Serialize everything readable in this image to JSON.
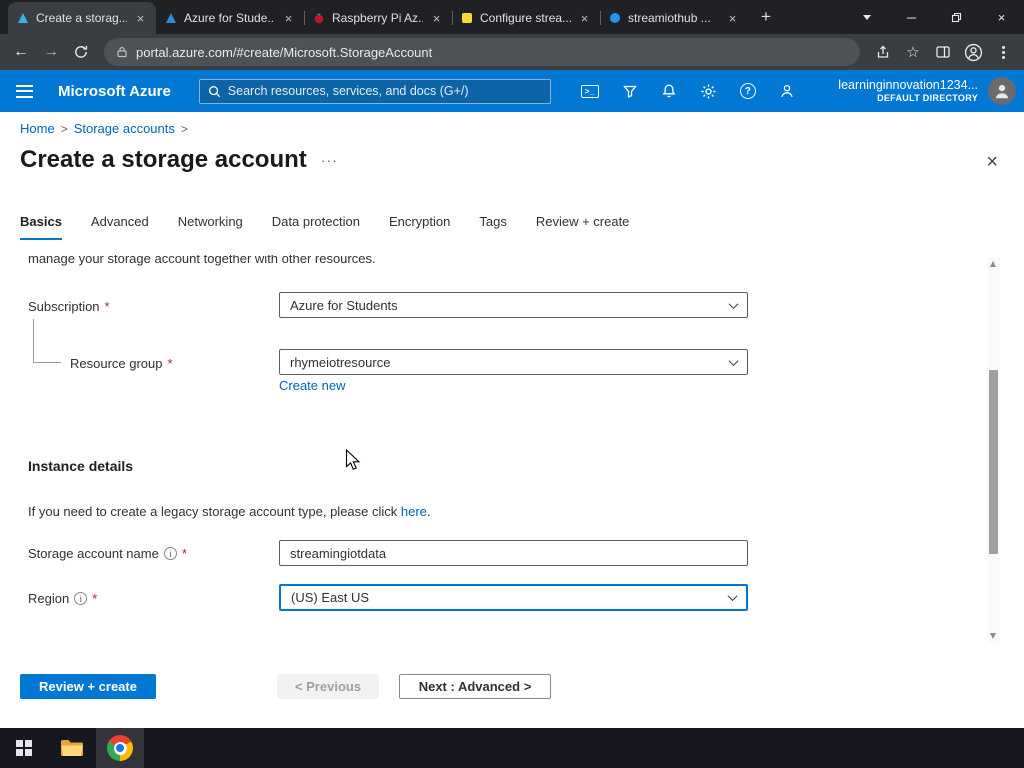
{
  "colors": {
    "azure_blue": "#0078d4",
    "link": "#0065b3",
    "primary_button": "#0078d4",
    "focus_border": "#0078d4",
    "required_marker": "#a4262c"
  },
  "icons": {
    "close": "×",
    "minimize": "─",
    "new_tab": "+",
    "back": "←",
    "forward": "→",
    "star": "☆"
  },
  "browser": {
    "tabs": [
      {
        "title": "Create a storag..."
      },
      {
        "title": "Azure for Stude..."
      },
      {
        "title": "Raspberry Pi Az..."
      },
      {
        "title": "Configure strea..."
      },
      {
        "title": "streamiothub ..."
      }
    ],
    "url": "portal.azure.com/#create/Microsoft.StorageAccount"
  },
  "azure": {
    "brand": "Microsoft Azure",
    "search_placeholder": "Search resources, services, and docs (G+/)",
    "account_name": "learninginnovation1234...",
    "directory": "DEFAULT DIRECTORY"
  },
  "breadcrumb": {
    "home": "Home",
    "storage_accounts": "Storage accounts",
    "separator": ">"
  },
  "page": {
    "title": "Create a storage account",
    "more": "···",
    "close": "×"
  },
  "wizard": {
    "tabs": [
      {
        "label": "Basics"
      },
      {
        "label": "Advanced"
      },
      {
        "label": "Networking"
      },
      {
        "label": "Data protection"
      },
      {
        "label": "Encryption"
      },
      {
        "label": "Tags"
      },
      {
        "label": "Review + create"
      }
    ]
  },
  "form": {
    "required": "*",
    "clipped_line": "manage your storage account together with other resources.",
    "subscription": {
      "label": "Subscription",
      "value": "Azure for Students"
    },
    "resource_group": {
      "label": "Resource group",
      "value": "rhymeiotresource",
      "create_new": "Create new"
    },
    "instance_details_heading": "Instance details",
    "legacy": {
      "prefix": "If you need to create a legacy storage account type, please click ",
      "link": "here",
      "suffix": "."
    },
    "storage_account_name": {
      "label": "Storage account name",
      "value": "streamingiotdata"
    },
    "region": {
      "label": "Region",
      "value": "(US) East US"
    }
  },
  "footer": {
    "review_create": "Review + create",
    "previous": "< Previous",
    "next": "Next : Advanced >"
  }
}
